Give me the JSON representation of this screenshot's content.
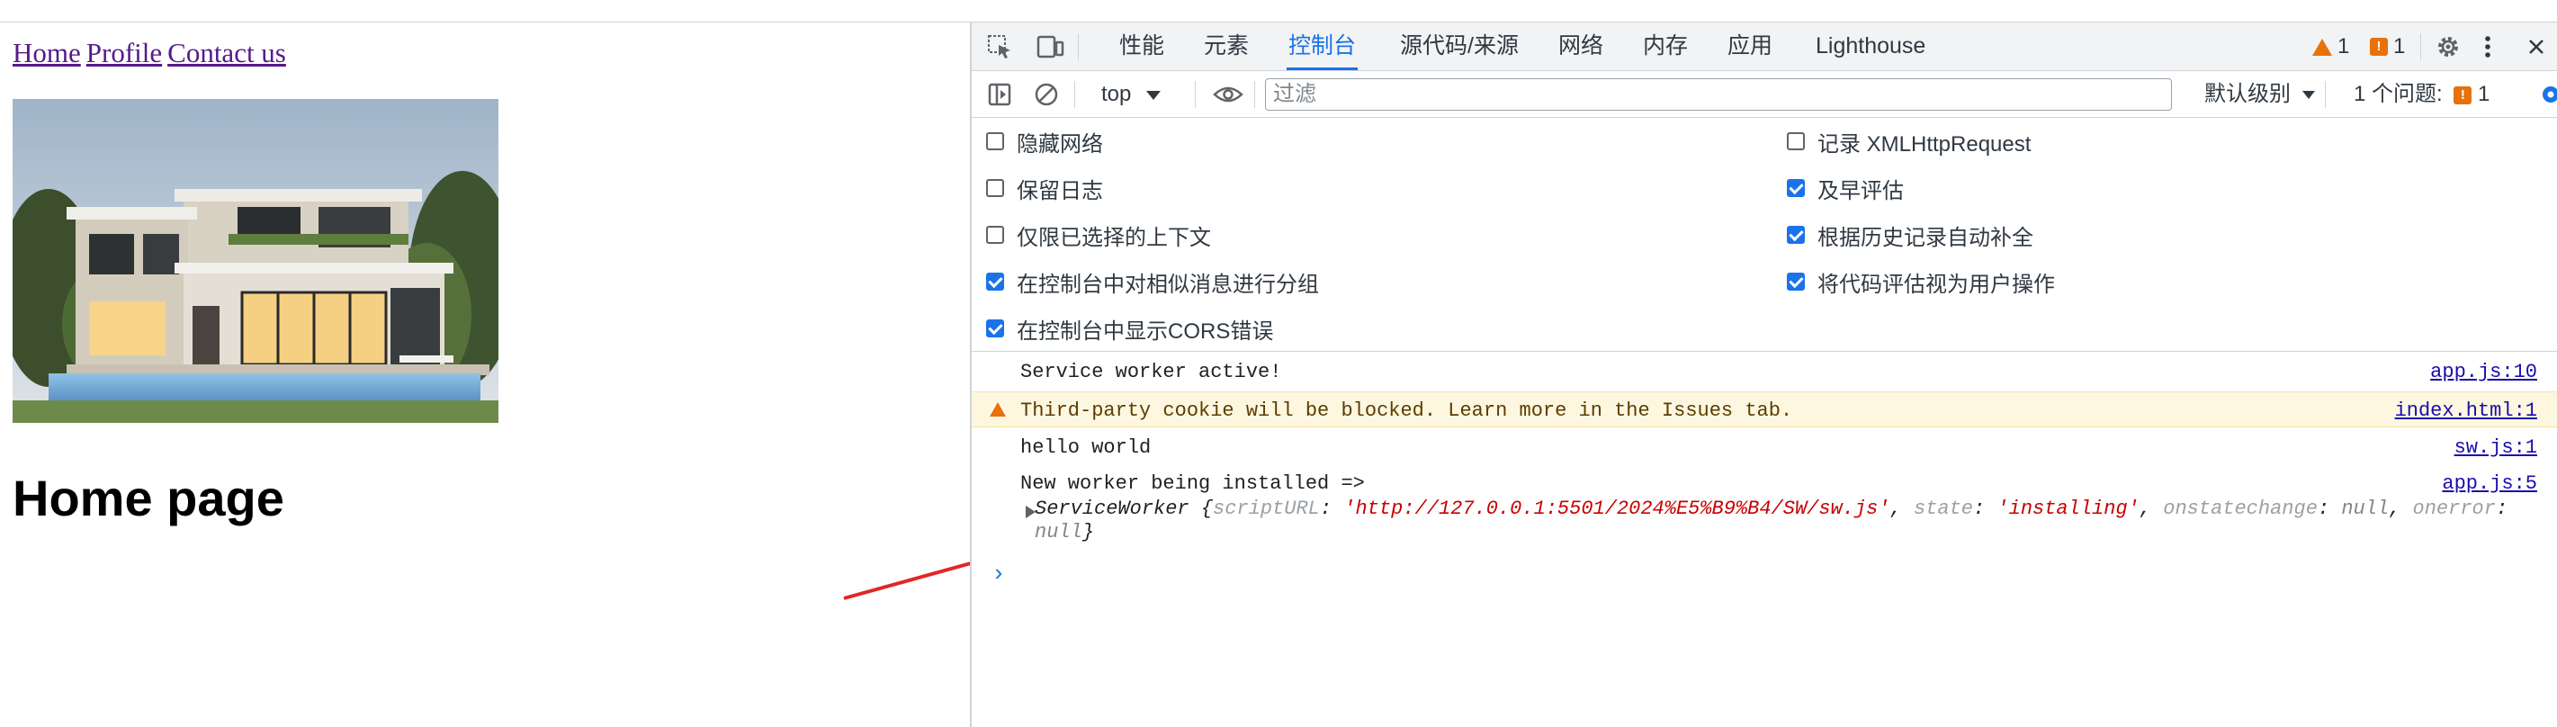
{
  "page": {
    "nav": [
      "Home",
      "Profile",
      "Contact us"
    ],
    "heading": "Home page"
  },
  "devtools": {
    "tabs": [
      "性能",
      "元素",
      "控制台",
      "源代码/来源",
      "网络",
      "内存",
      "应用",
      "Lighthouse"
    ],
    "active_tab": "控制台",
    "warning_count": "1",
    "issue_count": "1",
    "toolbar": {
      "context": "top",
      "filter_placeholder": "过滤",
      "level": "默认级别",
      "issues_label": "1 个问题:",
      "issues_count": "1"
    },
    "settings": {
      "left": [
        {
          "label": "隐藏网络",
          "checked": false
        },
        {
          "label": "保留日志",
          "checked": false
        },
        {
          "label": "仅限已选择的上下文",
          "checked": false
        },
        {
          "label": "在控制台中对相似消息进行分组",
          "checked": true
        },
        {
          "label": "在控制台中显示CORS错误",
          "checked": true
        }
      ],
      "right": [
        {
          "label": "记录 XMLHttpRequest",
          "checked": false
        },
        {
          "label": "及早评估",
          "checked": true
        },
        {
          "label": "根据历史记录自动补全",
          "checked": true
        },
        {
          "label": "将代码评估视为用户操作",
          "checked": true
        }
      ]
    },
    "console": {
      "messages": [
        {
          "text": "Service worker active!",
          "source": "app.js:10"
        },
        {
          "text": "Third-party cookie will be blocked. Learn more in the Issues tab.",
          "source": "index.html:1",
          "level": "warning"
        },
        {
          "text": "hello world",
          "source": "sw.js:1"
        },
        {
          "text": "New worker being installed =>",
          "source": "app.js:5"
        }
      ],
      "object": {
        "name": "ServiceWorker",
        "scriptURL_key": "scriptURL",
        "scriptURL": "'http://127.0.0.1:5501/2024%E5%B9%B4/SW/sw.js'",
        "state_key": "state",
        "state": "'installing'",
        "onstatechange_key": "onstatechange",
        "onstatechange": "null",
        "onerror_key": "onerror",
        "onerror": "null"
      }
    }
  }
}
